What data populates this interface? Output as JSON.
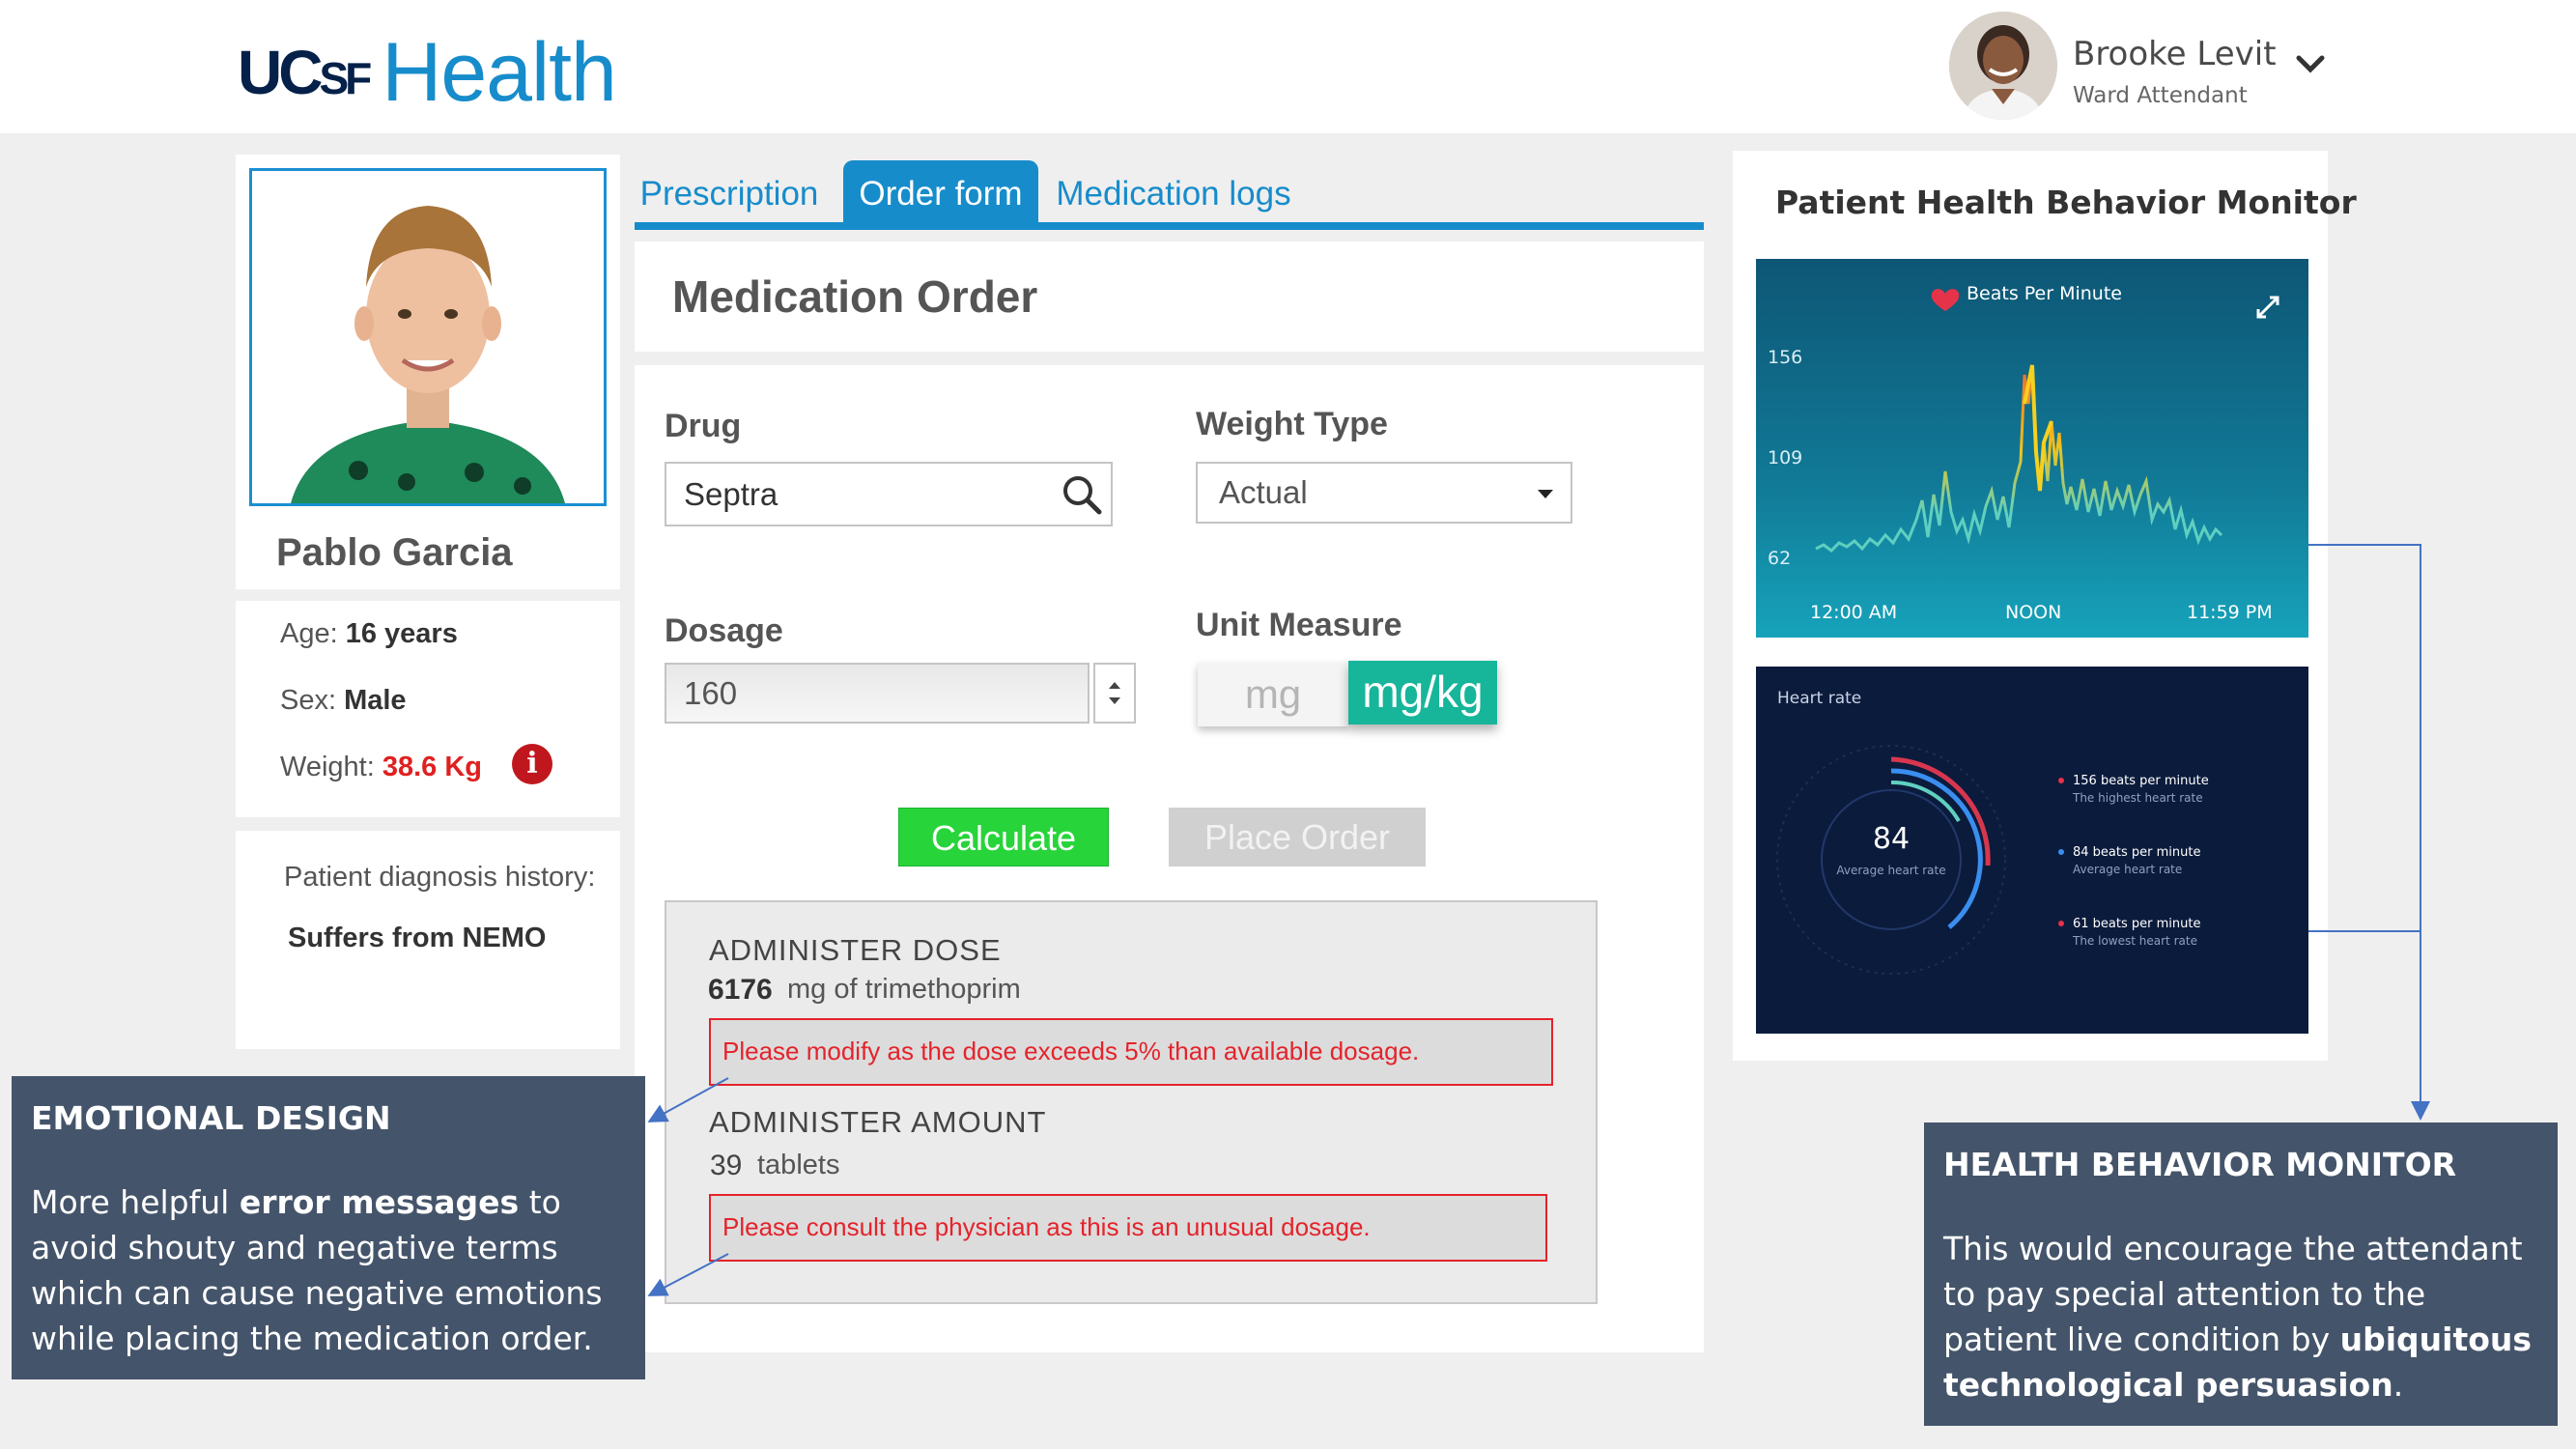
{
  "header": {
    "logo_ucsf": "UCSF",
    "logo_health": "Health",
    "user_name": "Brooke Levit",
    "user_role": "Ward Attendant"
  },
  "patient": {
    "name": "Pablo Garcia",
    "age_label": "Age:",
    "age_value": "16 years",
    "sex_label": "Sex:",
    "sex_value": "Male",
    "weight_label": "Weight:",
    "weight_value": "38.6 Kg",
    "history_label": "Patient diagnosis history:",
    "history_text": "Suffers from NEMO"
  },
  "tabs": [
    {
      "label": "Prescription",
      "active": false
    },
    {
      "label": "Order form",
      "active": true
    },
    {
      "label": "Medication logs",
      "active": false
    }
  ],
  "form": {
    "title": "Medication Order",
    "drug_label": "Drug",
    "drug_value": "Septra",
    "weight_type_label": "Weight Type",
    "weight_type_value": "Actual",
    "dosage_label": "Dosage",
    "dosage_value": "160",
    "unit_label": "Unit Measure",
    "unit_options": [
      "mg",
      "mg/kg"
    ],
    "unit_selected": "mg/kg",
    "calculate_label": "Calculate",
    "place_order_label": "Place Order"
  },
  "result": {
    "dose_heading": "ADMINISTER DOSE",
    "dose_value": "6176",
    "dose_unit": "mg of trimethoprim",
    "dose_error": "Please modify as the dose exceeds 5% than available dosage.",
    "amount_heading": "ADMINISTER AMOUNT",
    "amount_value": "39",
    "amount_unit": "tablets",
    "amount_error": "Please consult the physician as this is an unusual dosage."
  },
  "monitor": {
    "title": "Patient Health Behavior Monitor",
    "bpm_chart": {
      "title": "Beats Per Minute",
      "y_ticks": [
        "156",
        "109",
        "62"
      ],
      "x_ticks": [
        "12:00 AM",
        "NOON",
        "11:59 PM"
      ]
    },
    "heart_rate": {
      "title": "Heart rate",
      "average_value": "84",
      "average_label": "Average heart rate",
      "stats": [
        {
          "value": "156 beats per minute",
          "label": "The highest heart rate",
          "color": "#e5334a"
        },
        {
          "value": "84 beats per minute",
          "label": "Average heart rate",
          "color": "#3a8ef0"
        },
        {
          "value": "61 beats per minute",
          "label": "The lowest heart rate",
          "color": "#e5334a"
        }
      ]
    }
  },
  "annotations": {
    "emotional": {
      "title": "EMOTIONAL DESIGN",
      "body_1": "More helpful ",
      "body_bold": "error messages",
      "body_2": " to avoid shouty and negative terms which can cause negative emotions while placing the medication order."
    },
    "monitor": {
      "title": "HEALTH BEHAVIOR MONITOR",
      "body_1": "This would encourage the attendant to pay special attention to the patient live condition by ",
      "body_bold": "ubiquitous technological persuasion",
      "body_2": "."
    }
  },
  "colors": {
    "brand_blue": "#178ccb",
    "brand_navy": "#052049",
    "accent_teal": "#17b59a",
    "calculate_green": "#27d43a",
    "error_red": "#e4232b",
    "note_bg": "#44546a"
  }
}
